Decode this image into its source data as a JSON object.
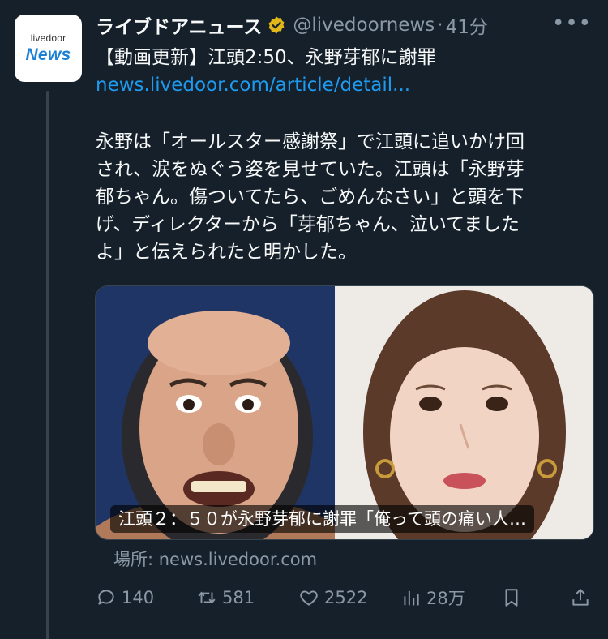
{
  "avatar": {
    "brand_small": "livedoor",
    "brand_big": "News"
  },
  "header": {
    "display_name": "ライブドアニュース",
    "handle": "@livedoornews",
    "separator": "·",
    "time": "41分",
    "more": "•••"
  },
  "tweet": {
    "headline": "【動画更新】江頭2:50、永野芽郁に謝罪",
    "link": "news.livedoor.com/article/detail...",
    "body_lines": [
      "永野は「オールスター感謝祭」で江頭に追いかけ回",
      "され、涙をぬぐう姿を見せていた。江頭は「永野芽",
      "郁ちゃん。傷ついてたら、ごめんなさい」と頭を下",
      "げ、ディレクターから「芽郁ちゃん、泣いてました",
      "よ」と伝えられたと明かした。"
    ]
  },
  "card": {
    "title": "江頭２：５０が永野芽郁に謝罪「俺って頭の痛い人…",
    "source": "場所: news.livedoor.com"
  },
  "actions": {
    "replies": "140",
    "retweets": "581",
    "likes": "2522",
    "views": "28万"
  },
  "colors": {
    "background": "#15202b",
    "text_primary": "#f7f9f9",
    "text_secondary": "#8b98a5",
    "link": "#1d9bf0",
    "verified": "#e2b719",
    "brand_blue": "#1a7fd6"
  },
  "icons": {
    "reply": "reply-icon",
    "retweet": "retweet-icon",
    "like": "heart-icon",
    "views": "views-icon",
    "bookmark": "bookmark-icon",
    "share": "share-icon",
    "verified": "verified-badge-icon"
  }
}
